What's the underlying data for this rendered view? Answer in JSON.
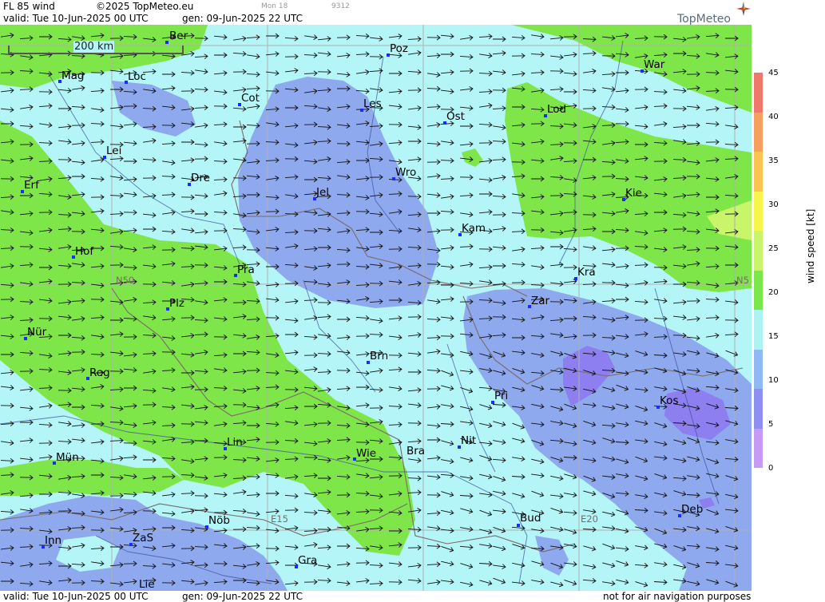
{
  "header": {
    "product": "FL 85 wind",
    "copyright": "©2025 TopMeteo.eu",
    "faint_left": "Mon 18",
    "faint_right": "9312",
    "valid": "valid:  Tue  10-Jun-2025  00 UTC",
    "generated": "gen: 09-Jun-2025 22 UTC",
    "logo": "TopMeteo"
  },
  "footer": {
    "valid": "valid:  Tue  10-Jun-2025  00 UTC",
    "generated": "gen: 09-Jun-2025 22 UTC",
    "note": "not for air navigation purposes"
  },
  "scale_bar": "200 km",
  "grid_labels": [
    "N50",
    "N5",
    "E15",
    "E20"
  ],
  "cities": [
    "Ber",
    "Poz",
    "War",
    "Mag",
    "Loc",
    "Cot",
    "Les",
    "Ost",
    "Lod",
    "Lei",
    "Erf",
    "Dre",
    "Wro",
    "Jel",
    "Kie",
    "Kam",
    "Hof",
    "Pra",
    "Kra",
    "Zar",
    "Plz",
    "Nür",
    "Brn",
    "Reg",
    "Pri",
    "Kos",
    "Lin",
    "Wie",
    "Bra",
    "Nit",
    "Mün",
    "Deb",
    "Nöb",
    "Bud",
    "Inn",
    "ZaS",
    "Gra",
    "Lie"
  ],
  "legend": {
    "unit": "wind  speed  [kt]",
    "ticks": [
      "45",
      "40",
      "35",
      "30",
      "25",
      "20",
      "15",
      "10",
      "5",
      "0"
    ],
    "colors": [
      "#f0786a",
      "#f5a060",
      "#f9c550",
      "#f7f54a",
      "#c9f56a",
      "#7ae84a",
      "#aef3f3",
      "#8fb9f2",
      "#8f8ff2",
      "#c79af5"
    ]
  },
  "palette": {
    "ocean_light": "#b4f5f7",
    "green": "#7fe64a",
    "blue": "#8ea9ee",
    "violet": "#8d7ff0"
  }
}
